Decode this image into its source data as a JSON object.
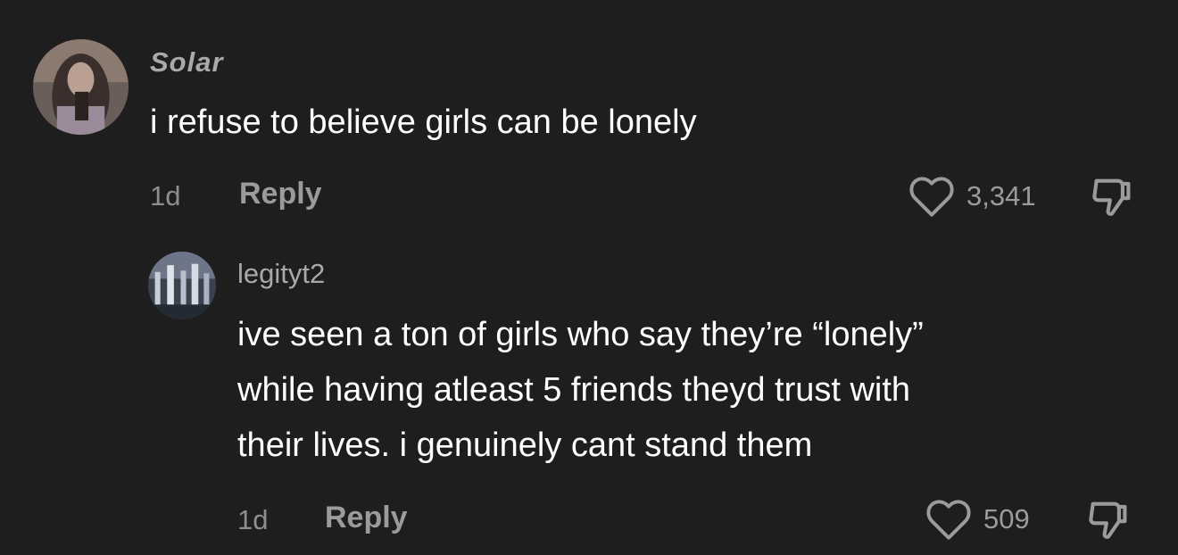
{
  "comments": [
    {
      "username": "Solar",
      "text": [
        "i refuse to believe girls can be lonely"
      ],
      "time": "1d",
      "reply_label": "Reply",
      "likes": "3,341",
      "avatar_icon": "profile-photo"
    },
    {
      "username": "legityt2",
      "text": [
        "ive seen a ton of girls who say they’re “lonely”",
        "while having atleast 5 friends theyd trust with",
        "their lives. i genuinely cant stand them"
      ],
      "time": "1d",
      "reply_label": "Reply",
      "likes": "509",
      "avatar_icon": "profile-photo"
    }
  ],
  "icons": {
    "like": "heart-outline-icon",
    "dislike": "thumbs-down-icon"
  },
  "colors": {
    "background": "#1e1e1e",
    "text": "#ffffff",
    "secondary": "#9b9b9b"
  }
}
